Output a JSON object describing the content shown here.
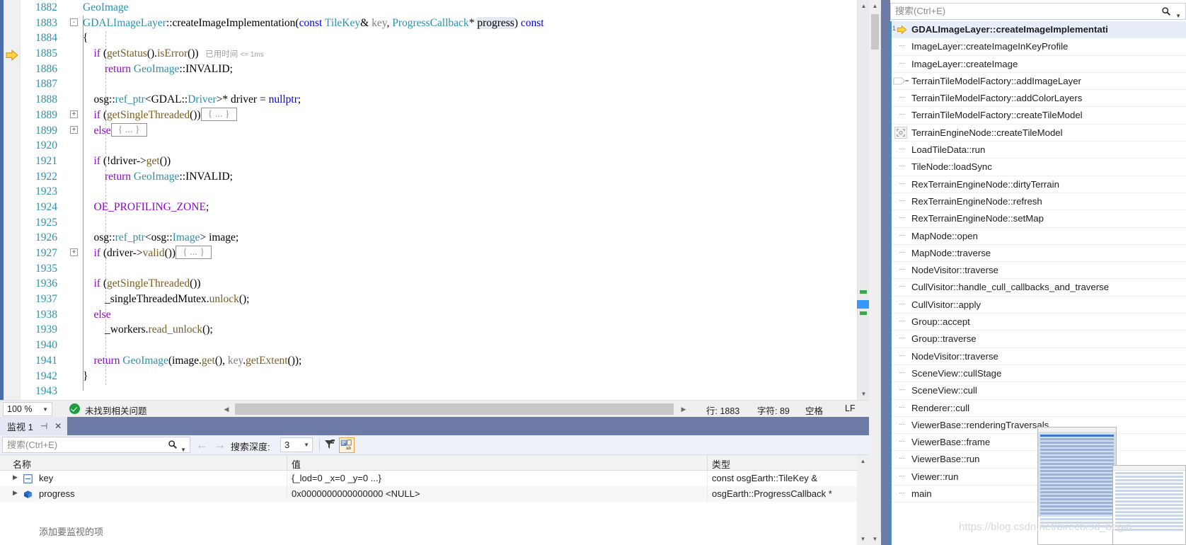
{
  "editor": {
    "lines": [
      {
        "num": "1882",
        "fold": "",
        "indent": 0,
        "tokens": [
          {
            "t": "GeoImage",
            "c": "typ"
          }
        ]
      },
      {
        "num": "1883",
        "fold": "-",
        "indent": 0,
        "tokens": [
          {
            "t": "GDALImageLayer",
            "c": "typ"
          },
          {
            "t": "::createImageImplementation(",
            "c": "plain"
          },
          {
            "t": "const",
            "c": "kw"
          },
          {
            "t": " ",
            "c": "plain"
          },
          {
            "t": "TileKey",
            "c": "typ"
          },
          {
            "t": "& ",
            "c": "plain"
          },
          {
            "t": "key",
            "c": "param"
          },
          {
            "t": ", ",
            "c": "plain"
          },
          {
            "t": "ProgressCallback",
            "c": "typ"
          },
          {
            "t": "* ",
            "c": "plain"
          },
          {
            "t": "progress",
            "c": "param-hl"
          },
          {
            "t": ") ",
            "c": "plain"
          },
          {
            "t": "const",
            "c": "kw"
          }
        ]
      },
      {
        "num": "1884",
        "fold": "",
        "indent": 0,
        "tokens": [
          {
            "t": "{",
            "c": "plain"
          }
        ]
      },
      {
        "num": "1885",
        "fold": "",
        "indent": 0,
        "current": true,
        "elapsed": "已用时间",
        "elapsed_value": "<= 1ms",
        "tokens": [
          {
            "t": "    ",
            "c": "plain"
          },
          {
            "t": "if",
            "c": "ctl"
          },
          {
            "t": " (",
            "c": "plain"
          },
          {
            "t": "getStatus",
            "c": "fn"
          },
          {
            "t": "().",
            "c": "plain"
          },
          {
            "t": "isError",
            "c": "fn"
          },
          {
            "t": "())",
            "c": "plain"
          }
        ]
      },
      {
        "num": "1886",
        "fold": "",
        "indent": 0,
        "tokens": [
          {
            "t": "        ",
            "c": "plain"
          },
          {
            "t": "return",
            "c": "ctl"
          },
          {
            "t": " ",
            "c": "plain"
          },
          {
            "t": "GeoImage",
            "c": "typ"
          },
          {
            "t": "::INVALID;",
            "c": "plain"
          }
        ]
      },
      {
        "num": "1887",
        "fold": "",
        "indent": 0,
        "tokens": []
      },
      {
        "num": "1888",
        "fold": "",
        "indent": 0,
        "tokens": [
          {
            "t": "    osg::",
            "c": "plain"
          },
          {
            "t": "ref_ptr",
            "c": "typ"
          },
          {
            "t": "<GDAL::",
            "c": "plain"
          },
          {
            "t": "Driver",
            "c": "typ"
          },
          {
            "t": ">* driver = ",
            "c": "plain"
          },
          {
            "t": "nullptr",
            "c": "kw"
          },
          {
            "t": ";",
            "c": "plain"
          }
        ]
      },
      {
        "num": "1889",
        "fold": "+",
        "indent": 0,
        "box": "{ ... }",
        "tokens": [
          {
            "t": "    ",
            "c": "plain"
          },
          {
            "t": "if",
            "c": "ctl"
          },
          {
            "t": " (",
            "c": "plain"
          },
          {
            "t": "getSingleThreaded",
            "c": "fn"
          },
          {
            "t": "())",
            "c": "plain"
          }
        ]
      },
      {
        "num": "1899",
        "fold": "+",
        "indent": 0,
        "box": "{ ... }",
        "tokens": [
          {
            "t": "    ",
            "c": "plain"
          },
          {
            "t": "else",
            "c": "ctl"
          }
        ]
      },
      {
        "num": "1920",
        "fold": "",
        "indent": 0,
        "tokens": []
      },
      {
        "num": "1921",
        "fold": "",
        "indent": 0,
        "tokens": [
          {
            "t": "    ",
            "c": "plain"
          },
          {
            "t": "if",
            "c": "ctl"
          },
          {
            "t": " (!driver->",
            "c": "plain"
          },
          {
            "t": "get",
            "c": "fn"
          },
          {
            "t": "())",
            "c": "plain"
          }
        ]
      },
      {
        "num": "1922",
        "fold": "",
        "indent": 0,
        "tokens": [
          {
            "t": "        ",
            "c": "plain"
          },
          {
            "t": "return",
            "c": "ctl"
          },
          {
            "t": " ",
            "c": "plain"
          },
          {
            "t": "GeoImage",
            "c": "typ"
          },
          {
            "t": "::INVALID;",
            "c": "plain"
          }
        ]
      },
      {
        "num": "1923",
        "fold": "",
        "indent": 0,
        "tokens": []
      },
      {
        "num": "1924",
        "fold": "",
        "indent": 0,
        "tokens": [
          {
            "t": "    ",
            "c": "plain"
          },
          {
            "t": "OE_PROFILING_ZONE",
            "c": "macro"
          },
          {
            "t": ";",
            "c": "plain"
          }
        ]
      },
      {
        "num": "1925",
        "fold": "",
        "indent": 0,
        "tokens": []
      },
      {
        "num": "1926",
        "fold": "",
        "indent": 0,
        "tokens": [
          {
            "t": "    osg::",
            "c": "plain"
          },
          {
            "t": "ref_ptr",
            "c": "typ"
          },
          {
            "t": "<osg::",
            "c": "plain"
          },
          {
            "t": "Image",
            "c": "typ"
          },
          {
            "t": "> image;",
            "c": "plain"
          }
        ]
      },
      {
        "num": "1927",
        "fold": "+",
        "indent": 0,
        "box": "{ ... }",
        "tokens": [
          {
            "t": "    ",
            "c": "plain"
          },
          {
            "t": "if",
            "c": "ctl"
          },
          {
            "t": " (driver->",
            "c": "plain"
          },
          {
            "t": "valid",
            "c": "fn"
          },
          {
            "t": "())",
            "c": "plain"
          }
        ]
      },
      {
        "num": "1935",
        "fold": "",
        "indent": 0,
        "tokens": []
      },
      {
        "num": "1936",
        "fold": "",
        "indent": 0,
        "tokens": [
          {
            "t": "    ",
            "c": "plain"
          },
          {
            "t": "if",
            "c": "ctl"
          },
          {
            "t": " (",
            "c": "plain"
          },
          {
            "t": "getSingleThreaded",
            "c": "fn"
          },
          {
            "t": "())",
            "c": "plain"
          }
        ]
      },
      {
        "num": "1937",
        "fold": "",
        "indent": 0,
        "tokens": [
          {
            "t": "        _singleThreadedMutex.",
            "c": "plain"
          },
          {
            "t": "unlock",
            "c": "fn"
          },
          {
            "t": "();",
            "c": "plain"
          }
        ]
      },
      {
        "num": "1938",
        "fold": "",
        "indent": 0,
        "tokens": [
          {
            "t": "    ",
            "c": "plain"
          },
          {
            "t": "else",
            "c": "ctl"
          }
        ]
      },
      {
        "num": "1939",
        "fold": "",
        "indent": 0,
        "tokens": [
          {
            "t": "        _workers.",
            "c": "plain"
          },
          {
            "t": "read_unlock",
            "c": "fn"
          },
          {
            "t": "();",
            "c": "plain"
          }
        ]
      },
      {
        "num": "1940",
        "fold": "",
        "indent": 0,
        "tokens": []
      },
      {
        "num": "1941",
        "fold": "",
        "indent": 0,
        "tokens": [
          {
            "t": "    ",
            "c": "plain"
          },
          {
            "t": "return",
            "c": "ctl"
          },
          {
            "t": " ",
            "c": "plain"
          },
          {
            "t": "GeoImage",
            "c": "typ"
          },
          {
            "t": "(image.",
            "c": "plain"
          },
          {
            "t": "get",
            "c": "fn"
          },
          {
            "t": "(), ",
            "c": "plain"
          },
          {
            "t": "key",
            "c": "param"
          },
          {
            "t": ".",
            "c": "plain"
          },
          {
            "t": "getExtent",
            "c": "fn"
          },
          {
            "t": "());",
            "c": "plain"
          }
        ]
      },
      {
        "num": "1942",
        "fold": "",
        "indent": 0,
        "tokens": [
          {
            "t": "}",
            "c": "plain"
          }
        ]
      },
      {
        "num": "1943",
        "fold": "",
        "indent": 0,
        "tokens": []
      }
    ]
  },
  "editor_status": {
    "zoom": "100 %",
    "problems": "未找到相关问题",
    "line_label": "行: 1883",
    "char_label": "字符: 89",
    "indent_mode": "空格",
    "line_ending": "LF"
  },
  "watch": {
    "tab_title": "监视 1",
    "search_placeholder": "搜索(Ctrl+E)",
    "depth_label": "搜索深度:",
    "depth_value": "3",
    "columns": [
      "名称",
      "值",
      "类型"
    ],
    "rows": [
      {
        "name": "key",
        "value": "{_lod=0 _x=0 _y=0 ...}",
        "type": "const osgEarth::TileKey &",
        "icon": "struct-icon"
      },
      {
        "name": "progress",
        "value": "0x0000000000000000 <NULL>",
        "type": "osgEarth::ProgressCallback *",
        "icon": "pointer-icon"
      }
    ],
    "add_row_hint": "添加要监视的项"
  },
  "callstack": {
    "search_placeholder": "搜索(Ctrl+E)",
    "frames": [
      {
        "label": "GDALImageLayer::createImageImplementati",
        "marker": "current",
        "index": "1",
        "selected": true
      },
      {
        "label": "ImageLayer::createImageInKeyProfile",
        "marker": "dash"
      },
      {
        "label": "ImageLayer::createImage",
        "marker": "dash"
      },
      {
        "label": "TerrainTileModelFactory::addImageLayer",
        "marker": "tailcall"
      },
      {
        "label": "TerrainTileModelFactory::addColorLayers",
        "marker": "dash"
      },
      {
        "label": "TerrainTileModelFactory::createTileModel",
        "marker": "dash"
      },
      {
        "label": "TerrainEngineNode::createTileModel",
        "marker": "nonuser"
      },
      {
        "label": "LoadTileData::run",
        "marker": "dash"
      },
      {
        "label": "TileNode::loadSync",
        "marker": "dash"
      },
      {
        "label": "RexTerrainEngineNode::dirtyTerrain",
        "marker": "dash"
      },
      {
        "label": "RexTerrainEngineNode::refresh",
        "marker": "dash"
      },
      {
        "label": "RexTerrainEngineNode::setMap",
        "marker": "dash"
      },
      {
        "label": "MapNode::open",
        "marker": "dash"
      },
      {
        "label": "MapNode::traverse",
        "marker": "dash"
      },
      {
        "label": "NodeVisitor::traverse",
        "marker": "dash"
      },
      {
        "label": "CullVisitor::handle_cull_callbacks_and_traverse",
        "marker": "dash"
      },
      {
        "label": "CullVisitor::apply",
        "marker": "dash"
      },
      {
        "label": "Group::accept",
        "marker": "dash"
      },
      {
        "label": "Group::traverse",
        "marker": "dash"
      },
      {
        "label": "NodeVisitor::traverse",
        "marker": "dash"
      },
      {
        "label": "SceneView::cullStage",
        "marker": "dash"
      },
      {
        "label": "SceneView::cull",
        "marker": "dash"
      },
      {
        "label": "Renderer::cull",
        "marker": "dash"
      },
      {
        "label": "ViewerBase::renderingTraversals",
        "marker": "dash"
      },
      {
        "label": "ViewerBase::frame",
        "marker": "dash"
      },
      {
        "label": "ViewerBase::run",
        "marker": "dash"
      },
      {
        "label": "Viewer::run",
        "marker": "dash"
      },
      {
        "label": "main",
        "marker": "dash"
      }
    ]
  },
  "watermark": "https://blog.csdn.net/directx3d_begin"
}
